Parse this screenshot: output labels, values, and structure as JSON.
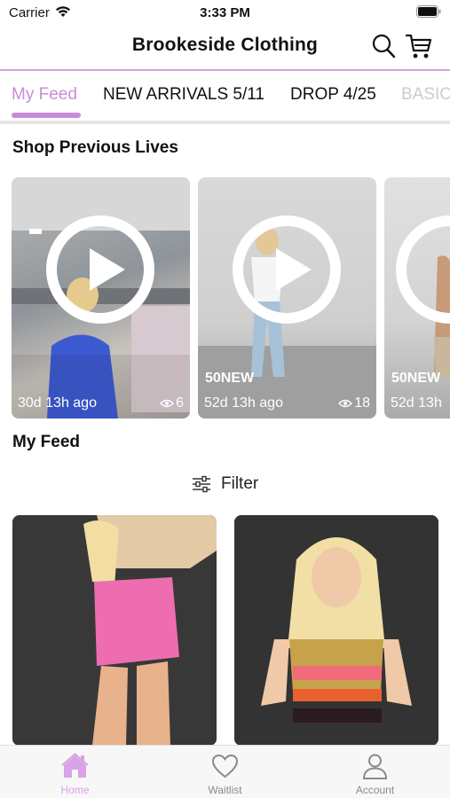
{
  "status_bar": {
    "carrier": "Carrier",
    "time": "3:33 PM",
    "icons": [
      "wifi-icon",
      "battery-icon"
    ]
  },
  "header": {
    "title": "Brookeside Clothing",
    "icons": [
      "search-icon",
      "cart-icon"
    ]
  },
  "tabs": [
    {
      "label": "My Feed",
      "active": true
    },
    {
      "label": "NEW ARRIVALS 5/11",
      "active": false
    },
    {
      "label": "DROP 4/25",
      "active": false
    },
    {
      "label": "BASICS",
      "active": false
    }
  ],
  "previous_lives": {
    "title": "Shop Previous Lives",
    "cards": [
      {
        "promo": "",
        "ago": "30d 13h ago",
        "views": "6"
      },
      {
        "promo": "50NEW",
        "ago": "52d 13h ago",
        "views": "18"
      },
      {
        "promo": "50NEW",
        "ago": "52d 13h",
        "views": ""
      }
    ]
  },
  "feed": {
    "title": "My Feed",
    "filter_label": "Filter",
    "item_count_visible": 2
  },
  "bottom_nav": [
    {
      "label": "Home",
      "icon": "home-icon",
      "active": true
    },
    {
      "label": "Waitlist",
      "icon": "heart-icon",
      "active": false
    },
    {
      "label": "Account",
      "icon": "user-icon",
      "active": false
    }
  ],
  "colors": {
    "accent": "#c98bdb",
    "nav_active": "#d9a3e6",
    "nav_inactive": "#8a8a8a",
    "divider": "#e6e6e6"
  }
}
